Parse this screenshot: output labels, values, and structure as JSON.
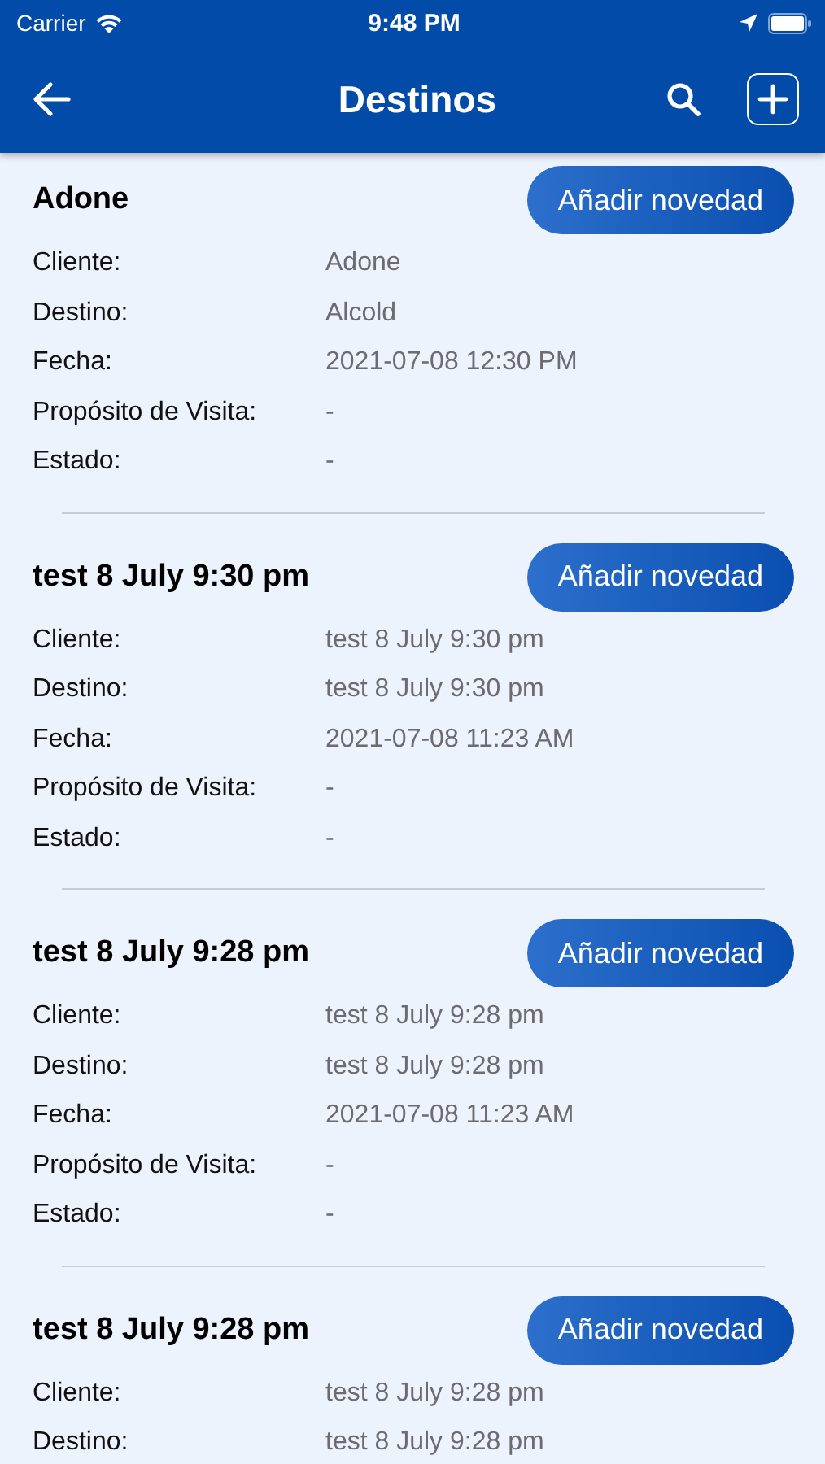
{
  "status_bar": {
    "carrier": "Carrier",
    "time": "9:48 PM"
  },
  "nav": {
    "title": "Destinos"
  },
  "cards": [
    {
      "title": "Adone",
      "button": "Añadir novedad",
      "rows": [
        {
          "label": "Cliente:",
          "value": "Adone"
        },
        {
          "label": "Destino:",
          "value": "Alcold"
        },
        {
          "label": "Fecha:",
          "value": "2021-07-08 12:30 PM"
        },
        {
          "label": "Propósito de Visita:",
          "value": "-"
        },
        {
          "label": "Estado:",
          "value": "-"
        }
      ]
    },
    {
      "title": "test 8 July 9:30 pm",
      "button": "Añadir novedad",
      "rows": [
        {
          "label": "Cliente:",
          "value": "test 8 July 9:30 pm"
        },
        {
          "label": "Destino:",
          "value": "test 8 July 9:30 pm"
        },
        {
          "label": "Fecha:",
          "value": "2021-07-08 11:23 AM"
        },
        {
          "label": "Propósito de Visita:",
          "value": "-"
        },
        {
          "label": "Estado:",
          "value": "-"
        }
      ]
    },
    {
      "title": "test 8 July 9:28 pm",
      "button": "Añadir novedad",
      "rows": [
        {
          "label": "Cliente:",
          "value": "test 8 July 9:28 pm"
        },
        {
          "label": "Destino:",
          "value": "test 8 July 9:28 pm"
        },
        {
          "label": "Fecha:",
          "value": "2021-07-08 11:23 AM"
        },
        {
          "label": "Propósito de Visita:",
          "value": "-"
        },
        {
          "label": "Estado:",
          "value": "-"
        }
      ]
    },
    {
      "title": "test 8 July 9:28 pm",
      "button": "Añadir novedad",
      "rows": [
        {
          "label": "Cliente:",
          "value": "test 8 July 9:28 pm"
        },
        {
          "label": "Destino:",
          "value": "test 8 July 9:28 pm"
        }
      ]
    }
  ]
}
